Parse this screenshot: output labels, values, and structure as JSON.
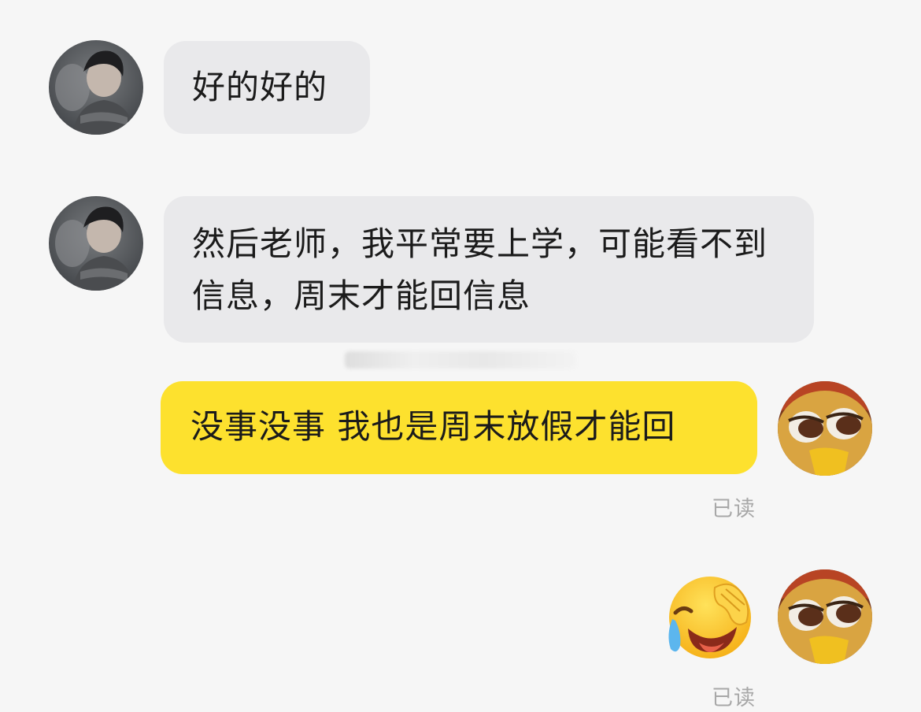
{
  "messages": [
    {
      "direction": "in",
      "text": "好的好的"
    },
    {
      "direction": "in",
      "text": "然后老师，我平常要上学，可能看不到信息，周末才能回信息"
    },
    {
      "direction": "out",
      "text": "没事没事 我也是周末放假才能回",
      "status": "已读"
    },
    {
      "direction": "out",
      "sticker": "crying-laughing-emoji",
      "status": "已读"
    }
  ],
  "colors": {
    "background": "#f6f6f6",
    "incoming_bubble": "#e9e9eb",
    "outgoing_bubble": "#fde12e",
    "read_receipt": "#a8a8a8"
  }
}
